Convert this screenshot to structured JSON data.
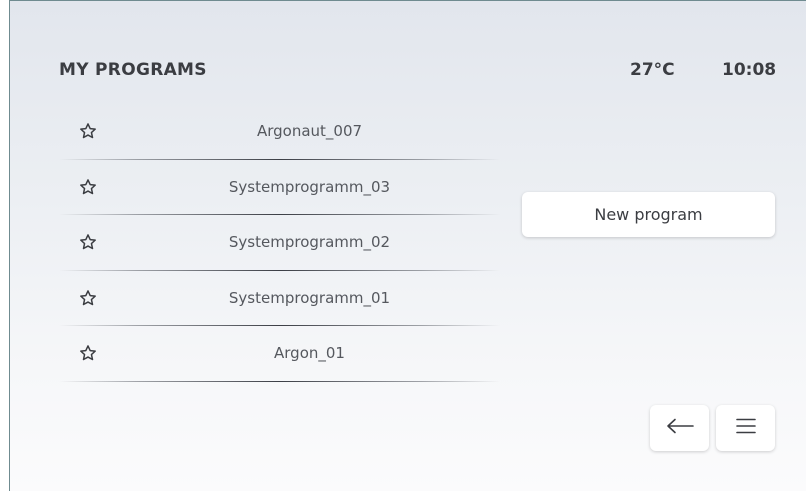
{
  "header": {
    "title": "MY PROGRAMS",
    "temperature": "27°C",
    "time": "10:08"
  },
  "programs": [
    {
      "name": "Argonaut_007",
      "icon": "star-outline-icon"
    },
    {
      "name": "Systemprogramm_03",
      "icon": "star-outline-icon"
    },
    {
      "name": "Systemprogramm_02",
      "icon": "star-outline-icon"
    },
    {
      "name": "Systemprogramm_01",
      "icon": "star-outline-icon"
    },
    {
      "name": "Argon_01",
      "icon": "star-outline-icon"
    }
  ],
  "actions": {
    "new_program_label": "New program"
  },
  "navigation": {
    "back_icon": "arrow-left-icon",
    "menu_icon": "hamburger-menu-icon"
  },
  "colors": {
    "text_dark": "#3b3d42",
    "text_list": "#55585e",
    "background_top": "#e2e6ed",
    "background_bottom": "#fbfbfc",
    "button_background": "#ffffff"
  }
}
